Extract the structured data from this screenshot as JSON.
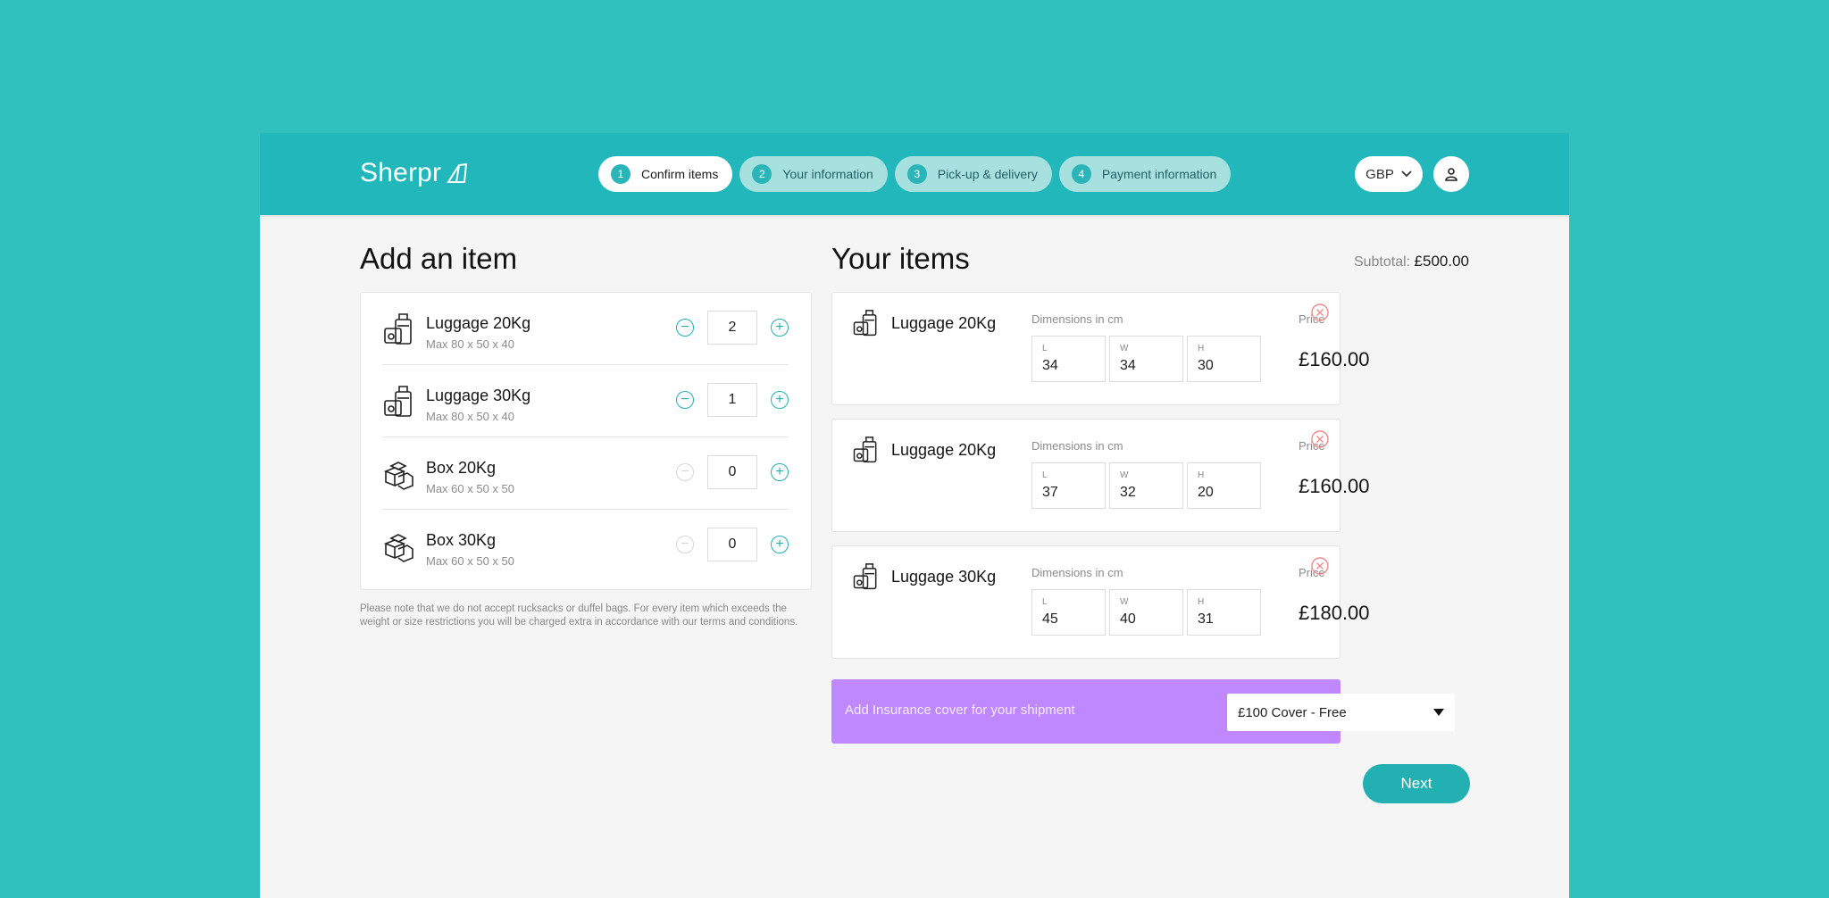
{
  "brand": {
    "name": "Sherpr"
  },
  "steps": [
    {
      "num": "1",
      "label": "Confirm items",
      "active": true
    },
    {
      "num": "2",
      "label": "Your information",
      "active": false
    },
    {
      "num": "3",
      "label": "Pick-up & delivery",
      "active": false
    },
    {
      "num": "4",
      "label": "Payment information",
      "active": false
    }
  ],
  "currency": {
    "selected": "GBP",
    "icon": "chevron-down-icon"
  },
  "user": {
    "icon": "user-icon"
  },
  "add_section": {
    "title": "Add an item",
    "items": [
      {
        "name": "Luggage 20Kg",
        "size": "Max 80 x 50 x 40",
        "qty": "2",
        "icon": "luggage-icon",
        "minus_enabled": true
      },
      {
        "name": "Luggage 30Kg",
        "size": "Max 80 x 50 x 40",
        "qty": "1",
        "icon": "luggage-icon",
        "minus_enabled": true
      },
      {
        "name": "Box 20Kg",
        "size": "Max 60 x 50 x 50",
        "qty": "0",
        "icon": "box-icon",
        "minus_enabled": false
      },
      {
        "name": "Box 30Kg",
        "size": "Max 60 x 50 x 50",
        "qty": "0",
        "icon": "box-icon",
        "minus_enabled": false
      }
    ],
    "note": "Please note that we do not accept rucksacks or duffel bags. For every item which exceeds the weight or size restrictions you will be charged extra in accordance with our terms and conditions."
  },
  "your_items": {
    "title": "Your items",
    "subtotal_label": "Subtotal:",
    "subtotal_value": "£500.00",
    "dimensions_label": "Dimensions in cm",
    "price_label": "Price",
    "dim_keys": {
      "l": "L",
      "w": "W",
      "h": "H"
    },
    "items": [
      {
        "name": "Luggage 20Kg",
        "l": "34",
        "w": "34",
        "h": "30",
        "price": "£160.00"
      },
      {
        "name": "Luggage 20Kg",
        "l": "37",
        "w": "32",
        "h": "20",
        "price": "£160.00"
      },
      {
        "name": "Luggage 30Kg",
        "l": "45",
        "w": "40",
        "h": "31",
        "price": "£180.00"
      }
    ]
  },
  "insurance": {
    "label": "Add Insurance cover for your shipment",
    "selected": "£100 Cover - Free",
    "background": "#c088ff"
  },
  "next_label": "Next",
  "colors": {
    "teal": "#30c1bf",
    "header": "#22b8bb",
    "accent": "#22b0b3",
    "remove": "#f08a8a"
  }
}
